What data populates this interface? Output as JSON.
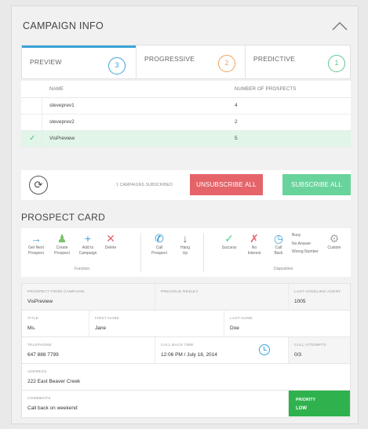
{
  "campaign_info": {
    "title": "CAMPAIGN INFO",
    "tabs": [
      {
        "label": "PREVIEW",
        "count": "3",
        "color": "#3ca3d8"
      },
      {
        "label": "PROGRESSIVE",
        "count": "2",
        "color": "#f0a15a"
      },
      {
        "label": "PREDICTIVE",
        "count": "1",
        "color": "#5bc98b"
      }
    ],
    "table": {
      "headers": [
        "NAME",
        "NUMBER OF PROSPECTS"
      ],
      "rows": [
        {
          "name": "steveprev1",
          "prospects": "4"
        },
        {
          "name": "steveprev2",
          "prospects": "2"
        },
        {
          "name": "VisPreview",
          "prospects": "5"
        }
      ]
    },
    "subscribed_count": "1 CAMPAIGNS SUBSCRIBED",
    "unsubscribe_all": "UNSUBSCRIBE ALL",
    "subscribe_all": "SUBSCRIBE ALL"
  },
  "prospect_card": {
    "title": "PROSPECT CARD",
    "function_tools": [
      {
        "label1": "Get Next",
        "label2": "Prospect",
        "icon": "arrow-right-icon",
        "glyph": "→",
        "color": "#3ca3d8"
      },
      {
        "label1": "Create",
        "label2": "Prospect",
        "icon": "person-icon",
        "glyph": "♟",
        "color": "#79c36a"
      },
      {
        "label1": "Add to",
        "label2": "Campaign",
        "icon": "plus-icon",
        "glyph": "+",
        "color": "#3ca3d8"
      },
      {
        "label1": "Delete",
        "label2": "",
        "icon": "x-icon",
        "glyph": "✕",
        "color": "#e4646a"
      }
    ],
    "function_label": "Function",
    "call_tools": [
      {
        "label1": "Call",
        "label2": "Prospect",
        "icon": "phone-icon",
        "glyph": "✆",
        "color": "#1a86c8"
      },
      {
        "label1": "Hang",
        "label2": "Up",
        "icon": "arrow-down-icon",
        "glyph": "↓",
        "color": "#777"
      }
    ],
    "disposition_tools": [
      {
        "label1": "Success",
        "label2": "",
        "icon": "check-icon",
        "glyph": "✓",
        "color": "#5bc98b"
      },
      {
        "label1": "No",
        "label2": "Interest",
        "icon": "no-interest-icon",
        "glyph": "✗",
        "color": "#e4646a"
      },
      {
        "label1": "Call",
        "label2": "Back",
        "icon": "clock-icon",
        "glyph": "◷",
        "color": "#3ca3d8"
      }
    ],
    "disposition_reasons": [
      "Busy",
      "No Answer",
      "Wrong Number"
    ],
    "custom_label": "Custom",
    "disposition_label": "Disposition",
    "fields": {
      "prospect_from_campaign": {
        "label": "PROSPECT FROM CAMPAIGN",
        "value": "VisPreview"
      },
      "previous_result": {
        "label": "PREVIOUS RESULT",
        "value": ""
      },
      "last_handling_agent": {
        "label": "LAST HANDLING AGENT",
        "value": "1005"
      },
      "title": {
        "label": "TITLE",
        "value": "Ms."
      },
      "first_name": {
        "label": "FIRST NAME",
        "value": "Jane"
      },
      "last_name": {
        "label": "LAST NAME",
        "value": "Doe"
      },
      "telephone": {
        "label": "TELEPHONE",
        "value": "647 888 7799"
      },
      "call_back_time": {
        "label": "CALL BACK TIME",
        "value": "12:06 PM / July 18, 2014"
      },
      "call_attempts": {
        "label": "CALL ATTEMPTS",
        "value": "0/3"
      },
      "address": {
        "label": "ADDRESS",
        "value": "222 East Beaver Creek"
      },
      "comments": {
        "label": "COMMENTS",
        "value": "Call back on weekend"
      },
      "priority": {
        "label": "PRIORITY",
        "value": "LOW"
      }
    }
  }
}
